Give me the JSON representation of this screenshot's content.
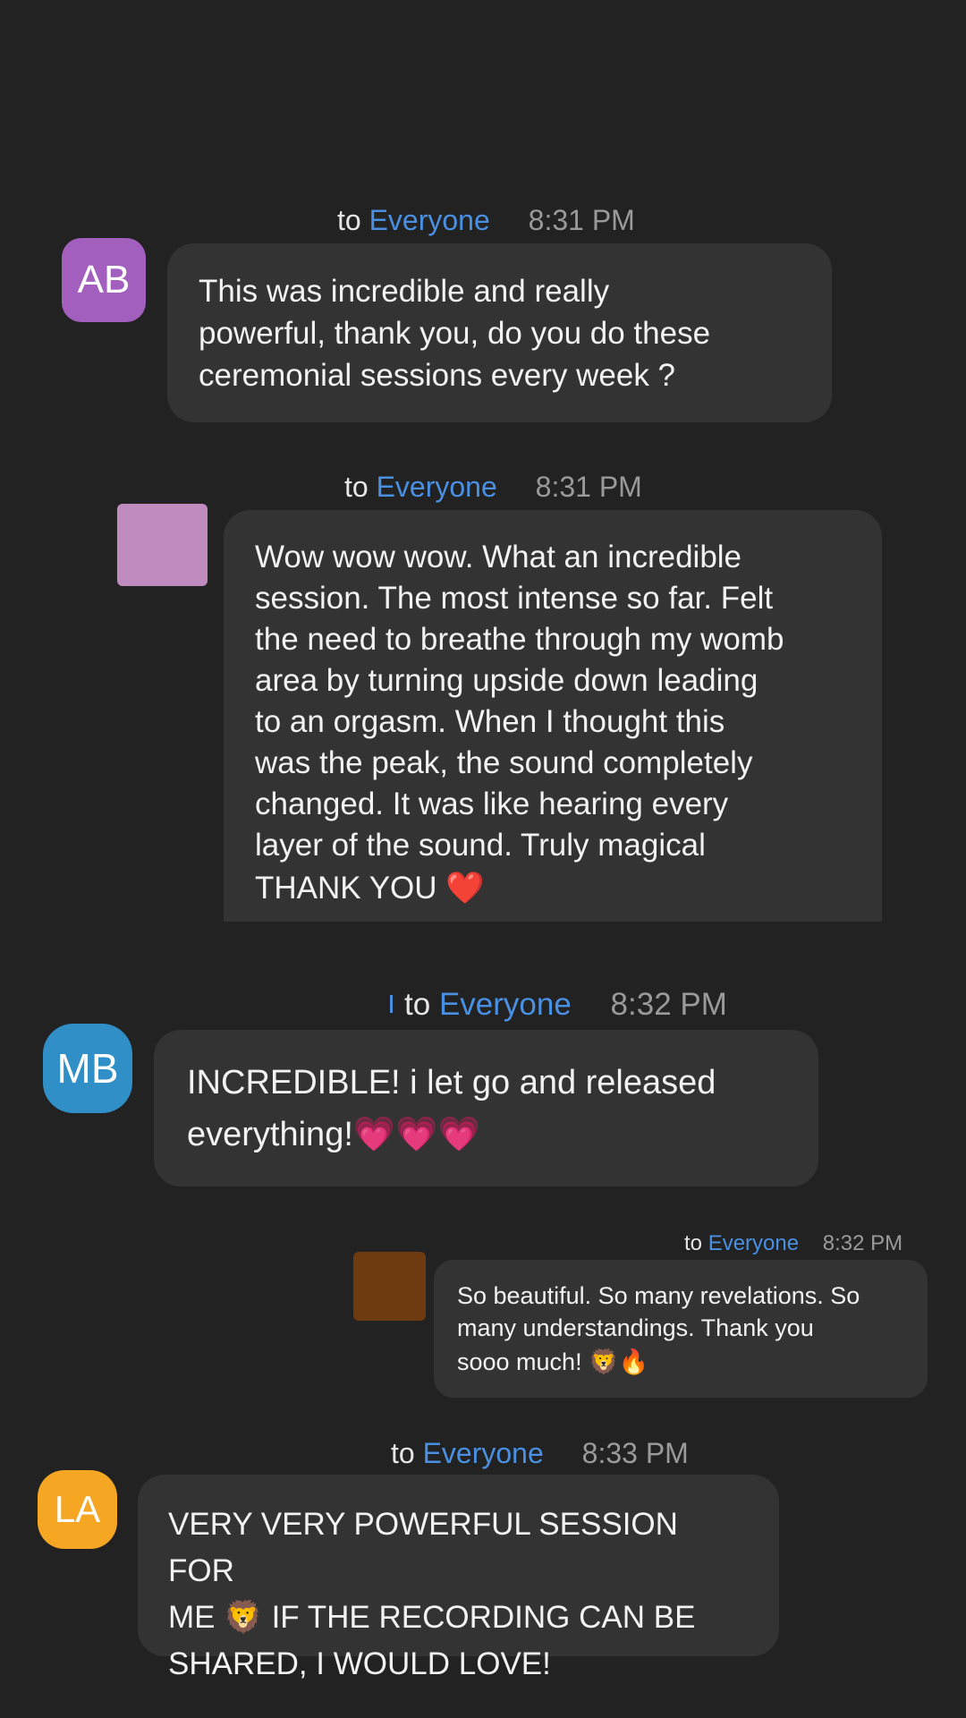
{
  "messages": [
    {
      "recipient_prefix": "to",
      "recipient": "Everyone",
      "time": "8:31 PM",
      "avatar": {
        "initials": "AB",
        "color": "#a35fbd"
      },
      "text": "This was incredible and really\npowerful, thank you, do you do these\nceremonial sessions every week ?"
    },
    {
      "recipient_prefix": "to",
      "recipient": "Everyone",
      "time": "8:31 PM",
      "avatar": {
        "initials": "",
        "color": "#c08cc0"
      },
      "text": "Wow wow wow. What an incredible\nsession. The most intense so far. Felt\nthe need to breathe through my womb\narea by turning upside down leading\nto an orgasm. When I thought this\nwas the peak, the sound completely\nchanged. It was like hearing every\nlayer of the sound. Truly magical",
      "text_last": "THANK YOU",
      "emoji": "❤️"
    },
    {
      "recipient_prefix": "to",
      "recipient": "Everyone",
      "time": "8:32 PM",
      "avatar": {
        "initials": "MB",
        "color": "#2f8fc6"
      },
      "text_line1": "INCREDIBLE!  i let go and  released",
      "text_line2": "everything!",
      "emoji": "💗💗💗"
    },
    {
      "recipient_prefix": "to",
      "recipient": "Everyone",
      "time": "8:32 PM",
      "avatar": {
        "initials": "",
        "color": "#6e3a10"
      },
      "text": "So beautiful. So many revelations. So\nmany understandings. Thank you",
      "text_last": "sooo much!",
      "emoji": "🦁🔥"
    },
    {
      "recipient_prefix": "to",
      "recipient": "Everyone",
      "time": "8:33 PM",
      "avatar": {
        "initials": "LA",
        "color": "#f5a623"
      },
      "text_line1": "VERY VERY POWERFUL SESSION FOR",
      "text_line2_before": "ME",
      "emoji": "🦁",
      "text_line2_after": "IF THE RECORDING CAN BE",
      "text_line3": "SHARED, I WOULD LOVE!"
    }
  ]
}
